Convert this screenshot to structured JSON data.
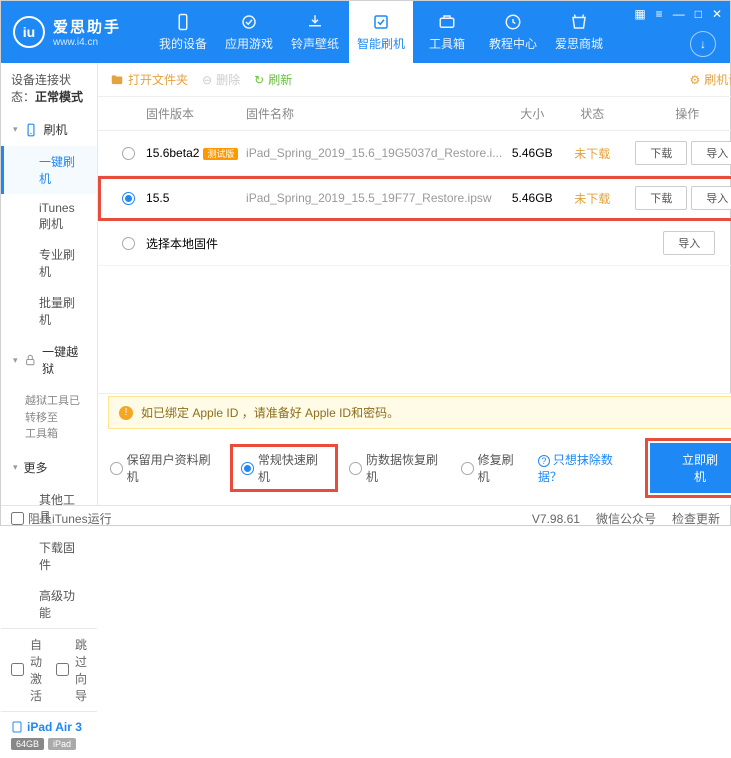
{
  "app": {
    "name": "爱思助手",
    "url": "www.i4.cn",
    "logo_letter": "iu"
  },
  "nav": [
    {
      "label": "我的设备"
    },
    {
      "label": "应用游戏"
    },
    {
      "label": "铃声壁纸"
    },
    {
      "label": "智能刷机",
      "active": true
    },
    {
      "label": "工具箱"
    },
    {
      "label": "教程中心"
    },
    {
      "label": "爱思商城"
    }
  ],
  "conn": {
    "prefix": "设备连接状态：",
    "status": "正常模式"
  },
  "side": {
    "flash": {
      "title": "刷机",
      "items": [
        "一键刷机",
        "iTunes刷机",
        "专业刷机",
        "批量刷机"
      ],
      "active": 0
    },
    "jb": {
      "title": "一键越狱",
      "note": "越狱工具已转移至\n工具箱"
    },
    "more": {
      "title": "更多",
      "items": [
        "其他工具",
        "下载固件",
        "高级功能"
      ]
    }
  },
  "sidefoot": {
    "auto": "自动激活",
    "skip": "跳过向导"
  },
  "device": {
    "name": "iPad Air 3",
    "cap": "64GB",
    "type": "iPad"
  },
  "toolbar": {
    "open": "打开文件夹",
    "del": "删除",
    "refresh": "刷新",
    "settings": "刷机设置"
  },
  "table": {
    "headers": {
      "ver": "固件版本",
      "name": "固件名称",
      "size": "大小",
      "status": "状态",
      "ops": "操作"
    },
    "rows": [
      {
        "ver": "15.6beta2",
        "badge": "测试版",
        "name": "iPad_Spring_2019_15.6_19G5037d_Restore.i...",
        "size": "5.46GB",
        "status": "未下载",
        "selected": false,
        "hl": false
      },
      {
        "ver": "15.5",
        "badge": "",
        "name": "iPad_Spring_2019_15.5_19F77_Restore.ipsw",
        "size": "5.46GB",
        "status": "未下载",
        "selected": true,
        "hl": true
      }
    ],
    "local": "选择本地固件",
    "btn_dl": "下载",
    "btn_imp": "导入"
  },
  "warn": "如已绑定 Apple ID ，请准备好 Apple ID和密码。",
  "modes": [
    {
      "label": "保留用户资料刷机",
      "on": false
    },
    {
      "label": "常规快速刷机",
      "on": true,
      "hl": true
    },
    {
      "label": "防数据恢复刷机",
      "on": false
    },
    {
      "label": "修复刷机",
      "on": false
    }
  ],
  "exclude": "只想抹除数据？",
  "flash_btn": "立即刷机",
  "status": {
    "block": "阻止iTunes运行",
    "ver": "V7.98.61",
    "wx": "微信公众号",
    "upd": "检查更新"
  }
}
